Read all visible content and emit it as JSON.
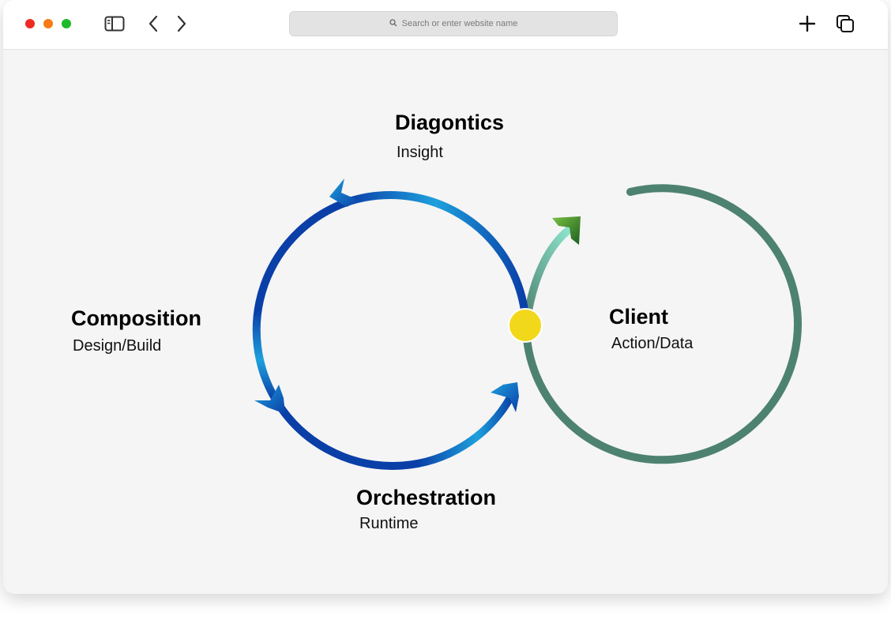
{
  "browser": {
    "address_placeholder": "Search or enter website name",
    "icons": [
      "close-dot",
      "minimize-dot",
      "maximize-dot",
      "sidebar-icon",
      "back-icon",
      "forward-icon",
      "search-icon",
      "new-tab-icon",
      "tabs-overview-icon"
    ]
  },
  "diagram": {
    "nodes": [
      {
        "id": "diagnostics",
        "title": "Diagontics",
        "subtitle": "Insight"
      },
      {
        "id": "composition",
        "title": "Composition",
        "subtitle": "Design/Build"
      },
      {
        "id": "orchestration",
        "title": "Orchestration",
        "subtitle": "Runtime"
      },
      {
        "id": "client",
        "title": "Client",
        "subtitle": "Action/Data"
      }
    ],
    "colors": {
      "loop_dark_blue": "#0a3fa8",
      "loop_light_blue": "#1ea0dc",
      "client_loop": "#4e8270",
      "junction": "#f2d81a",
      "arrow_green": "#2e7d32",
      "arrow_mint": "#7fe0c8"
    }
  }
}
